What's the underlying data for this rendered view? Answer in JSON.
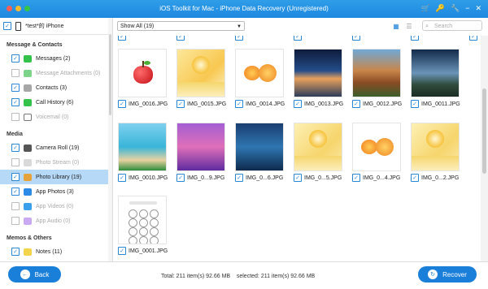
{
  "window": {
    "title": "iOS Toolkit for Mac - iPhone Data Recovery (Unregistered)"
  },
  "device": {
    "name": "*test*的 iPhone"
  },
  "sidebar": {
    "sections": [
      {
        "title": "Message & Contacts",
        "items": [
          {
            "label": "Messages (2)",
            "checked": true,
            "enabled": true,
            "icon": "messages-icon",
            "color": "#35c24b"
          },
          {
            "label": "Message Attachments (0)",
            "checked": false,
            "enabled": false,
            "icon": "attachments-icon",
            "color": "#7ed38a"
          },
          {
            "label": "Contacts (3)",
            "checked": true,
            "enabled": true,
            "icon": "contacts-icon",
            "color": "#a7a7a7"
          },
          {
            "label": "Call History (6)",
            "checked": true,
            "enabled": true,
            "icon": "phone-icon",
            "color": "#35c24b"
          },
          {
            "label": "Voicemail (0)",
            "checked": false,
            "enabled": false,
            "icon": "voicemail-icon",
            "color": "#ffffff"
          }
        ]
      },
      {
        "title": "Media",
        "items": [
          {
            "label": "Camera Roll (19)",
            "checked": true,
            "enabled": true,
            "icon": "camera-icon",
            "color": "#555555"
          },
          {
            "label": "Photo Stream (0)",
            "checked": false,
            "enabled": false,
            "icon": "photo-stream-icon",
            "color": "#d9d9d9"
          },
          {
            "label": "Photo Library (19)",
            "checked": true,
            "enabled": true,
            "icon": "photos-icon",
            "color": "#e7a33b",
            "selected": true
          },
          {
            "label": "App Photos (3)",
            "checked": true,
            "enabled": true,
            "icon": "app-store-icon",
            "color": "#2a8ae6"
          },
          {
            "label": "App Videos (0)",
            "checked": false,
            "enabled": false,
            "icon": "clapper-icon",
            "color": "#3aa0ec"
          },
          {
            "label": "App Audio (0)",
            "checked": false,
            "enabled": false,
            "icon": "music-icon",
            "color": "#c9a9f2"
          }
        ]
      },
      {
        "title": "Memos & Others",
        "items": [
          {
            "label": "Notes (11)",
            "checked": true,
            "enabled": true,
            "icon": "notes-icon",
            "color": "#f3d44a"
          }
        ]
      }
    ]
  },
  "toolbar": {
    "filter": "Show All (19)",
    "search_placeholder": "Search"
  },
  "photos": [
    {
      "name": "IMG_0016.JPG",
      "art": "apple"
    },
    {
      "name": "IMG_0015.JPG",
      "art": "sun"
    },
    {
      "name": "IMG_0014.JPG",
      "art": "mango"
    },
    {
      "name": "IMG_0013.JPG",
      "art": "lake"
    },
    {
      "name": "IMG_0012.JPG",
      "art": "canyon"
    },
    {
      "name": "IMG_0011.JPG",
      "art": "sky"
    },
    {
      "name": "IMG_0010.JPG",
      "art": "beach"
    },
    {
      "name": "IMG_0...9.JPG",
      "art": "purple"
    },
    {
      "name": "IMG_0...6.JPG",
      "art": "city"
    },
    {
      "name": "IMG_0...5.JPG",
      "art": "sun2"
    },
    {
      "name": "IMG_0...4.JPG",
      "art": "mango"
    },
    {
      "name": "IMG_0...2.JPG",
      "art": "sun2"
    },
    {
      "name": "IMG_0001.JPG",
      "art": "phone"
    }
  ],
  "footer": {
    "back_label": "Back",
    "recover_label": "Recover",
    "total": "Total: 211 item(s) 92.66 MB",
    "selected": "selected: 211 item(s) 92.66 MB"
  }
}
